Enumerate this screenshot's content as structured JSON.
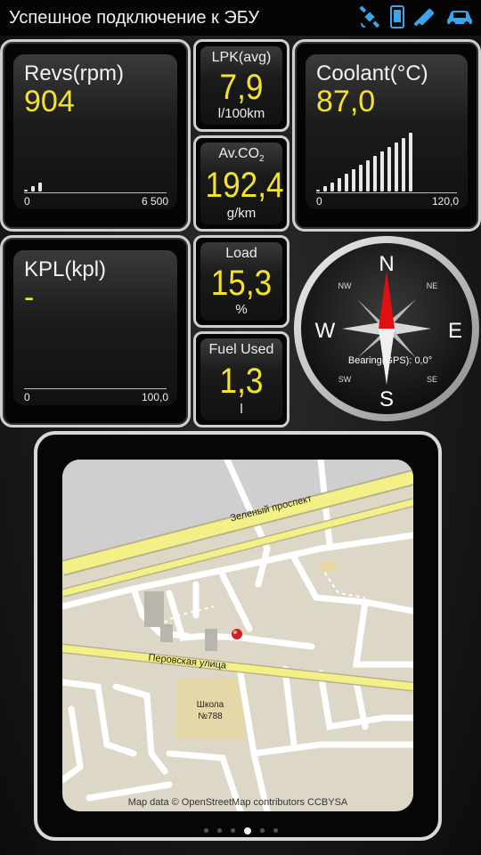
{
  "status_bar": {
    "title": "Успешное подключение к ЭБУ",
    "icons": [
      "gps-icon",
      "phone-icon",
      "bluetooth-icon",
      "car-icon"
    ],
    "accent": "#3aa5e8"
  },
  "revs": {
    "label": "Revs(rpm)",
    "value": "904",
    "min": "0",
    "max": "6 500"
  },
  "coolant": {
    "label": "Coolant(°C)",
    "value": "87,0",
    "min": "0",
    "max": "120,0"
  },
  "kpl": {
    "label": "KPL(kpl)",
    "value": "-",
    "min": "0",
    "max": "100,0"
  },
  "lpk": {
    "label": "LPK(avg)",
    "value": "7,9",
    "unit": "l/100km"
  },
  "co2": {
    "label_main": "Av.CO",
    "label_sub": "2",
    "value": "192,4",
    "unit": "g/km"
  },
  "load": {
    "label": "Load",
    "value": "15,3",
    "unit": "%"
  },
  "fuel": {
    "label": "Fuel Used",
    "value": "1,3",
    "unit": "l"
  },
  "compass": {
    "n": "N",
    "s": "S",
    "e": "E",
    "w": "W",
    "ne": "NE",
    "nw": "NW",
    "se": "SE",
    "sw": "SW",
    "bearing": "Bearing(GPS): 0,0°"
  },
  "map": {
    "street1": "Зеленый проспект",
    "street2": "Перовская улица",
    "school_line1": "Школа",
    "school_line2": "№788",
    "credit": "Map data © OpenStreetMap contributors CCBYSA"
  },
  "colors": {
    "value": "#f4e32b",
    "needle_north": "#e01010",
    "marker": "#d0202a"
  },
  "pager": {
    "pages": 6,
    "active": 4
  }
}
